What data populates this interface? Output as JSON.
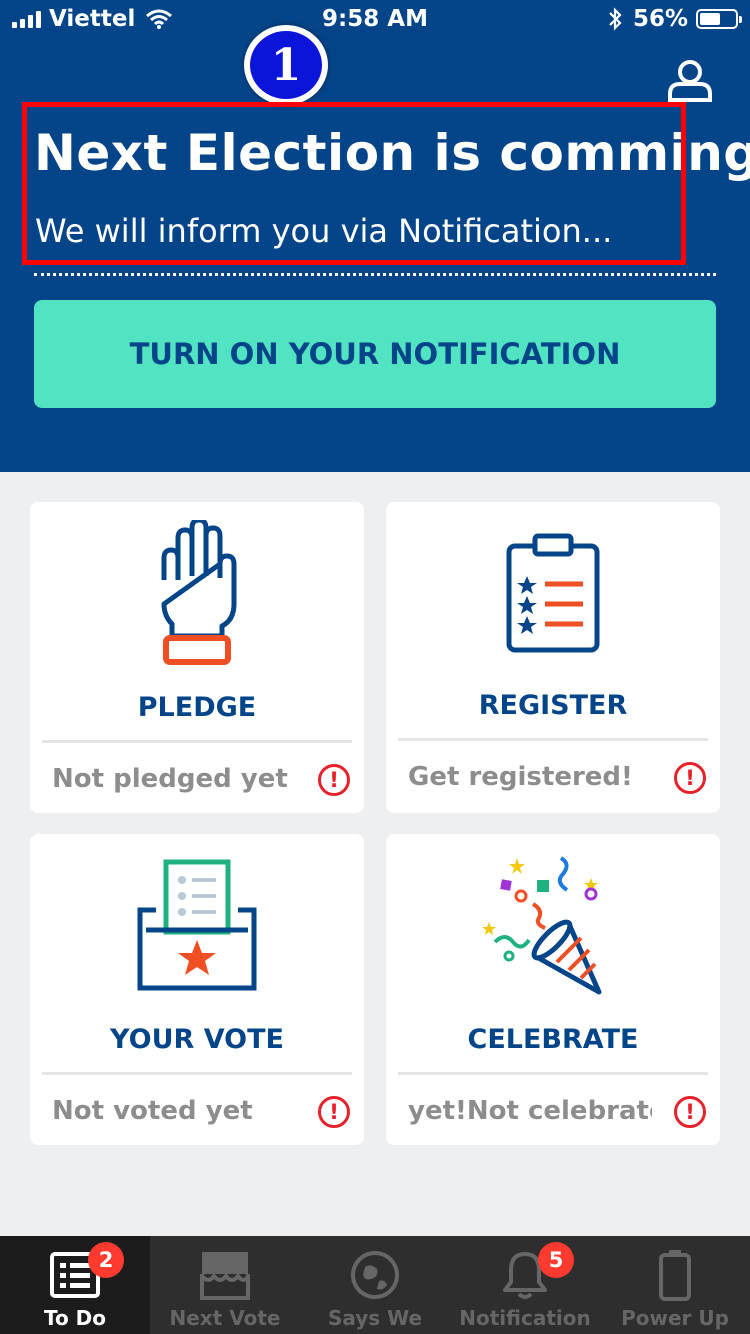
{
  "status_bar": {
    "carrier": "Viettel",
    "time": "9:58 AM",
    "battery": "56%"
  },
  "step_badge": "1",
  "header": {
    "title": "Next Election is comming!",
    "subtitle": "We will inform you via Notification...",
    "notify_button": "TURN ON YOUR NOTIFICATION"
  },
  "cards": [
    {
      "label": "PLEDGE",
      "status": "Not pledged yet",
      "alert": "!"
    },
    {
      "label": "REGISTER",
      "status": "Get registered!",
      "alert": "!"
    },
    {
      "label": "YOUR VOTE",
      "status": "Not voted yet",
      "alert": "!"
    },
    {
      "label": "CELEBRATE",
      "status": "yet!Not celebrated",
      "alert": "!"
    }
  ],
  "tabs": [
    {
      "label": "To Do",
      "badge": "2",
      "icon": "list-icon"
    },
    {
      "label": "Next Vote",
      "badge": "",
      "icon": "ballot-box-icon"
    },
    {
      "label": "Says We",
      "badge": "",
      "icon": "globe-icon"
    },
    {
      "label": "Notification",
      "badge": "5",
      "icon": "bell-icon"
    },
    {
      "label": "Power Up",
      "badge": "",
      "icon": "phone-icon"
    }
  ],
  "colors": {
    "header_bg": "#04458a",
    "accent_teal": "#51e3c2",
    "alert_red": "#e8202a",
    "annotation_red": "#ff0000"
  }
}
